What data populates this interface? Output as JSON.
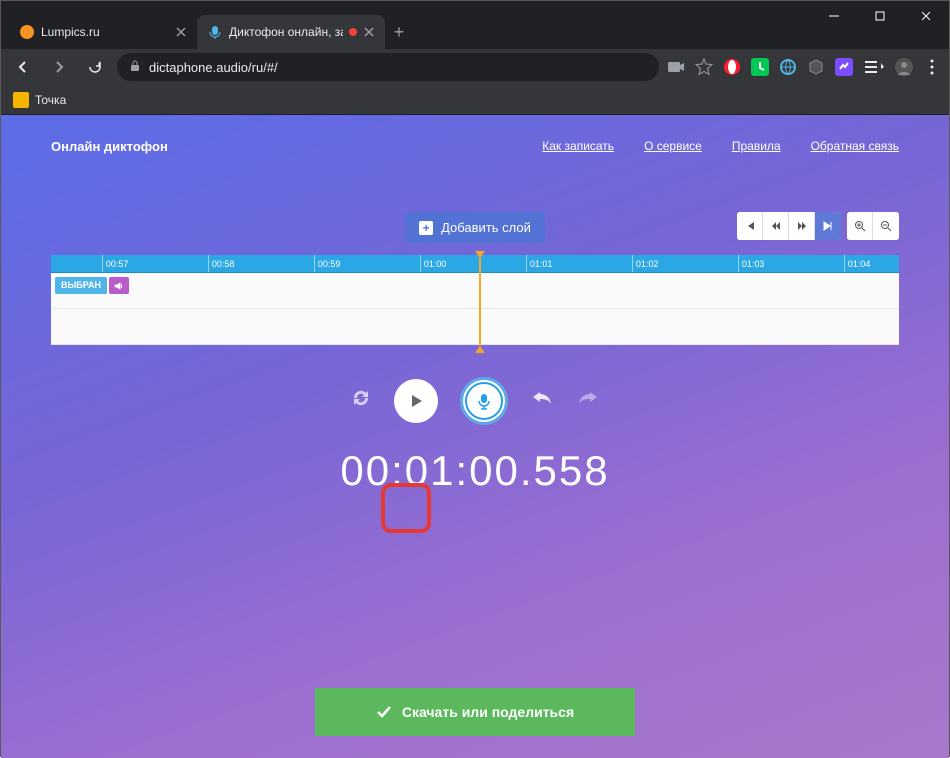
{
  "browser": {
    "tabs": [
      {
        "title": "Lumpics.ru"
      },
      {
        "title": "Диктофон онлайн, записать"
      }
    ],
    "url": "dictaphone.audio/ru/#/",
    "bookmark": "Точка"
  },
  "header": {
    "logo": "Онлайн диктофон",
    "nav": {
      "how": "Как записать",
      "about": "О сервисе",
      "rules": "Правила",
      "contact": "Обратная связь"
    }
  },
  "editor": {
    "add_layer": "Добавить слой",
    "ticks": [
      "00:57",
      "00:58",
      "00:59",
      "01:00",
      "01:01",
      "01:02",
      "01:03",
      "01:04"
    ],
    "selected_label": "ВЫБРАН"
  },
  "timer": "00:01:00.558",
  "download": "Скачать или поделиться"
}
